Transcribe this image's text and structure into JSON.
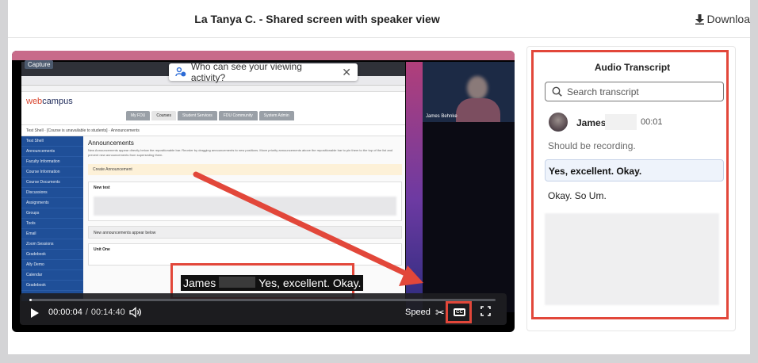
{
  "header": {
    "title": "La Tanya C. - Shared screen with speaker view",
    "download_label": "Downloa",
    "download_icon": "download-arrow-icon"
  },
  "shared_screen": {
    "capture_badge": "Capture",
    "privacy_popup": "Who can see your viewing activity?",
    "speaker_tile_name": "James Behnke",
    "campus_logo_a": "web",
    "campus_logo_b": "campus",
    "nav_tabs": [
      "My FDU",
      "Courses",
      "Student Services",
      "FDU Community",
      "System Admin"
    ],
    "breadcrumb": "Test Shell  ·  [Course is unavailable to students]  ·  Announcements",
    "left_nav": [
      "Test Shell",
      "Announcements",
      "Faculty Information",
      "Course Information",
      "Course Documents",
      "Discussions",
      "Assignments",
      "Groups",
      "Tools",
      "Email",
      "Zoom Sessions",
      "Gradebook",
      "Ally Demo",
      "Calendar",
      "Gradebook"
    ],
    "content_title": "Announcements",
    "content_desc": "New Announcements appear directly below the repositionable bar. Reorder by dragging announcements to new positions. Move priority announcements above the repositionable bar to pin them to the top of the list and prevent new announcements from superseding them.",
    "create_bar": "Create Announcement",
    "card1_title": "New test",
    "row_text": "New announcements appear below",
    "card2_title": "Unit One"
  },
  "caption": {
    "speaker": "James",
    "text": "Yes, excellent. Okay."
  },
  "controls": {
    "current_time": "00:00:04",
    "separator": "/",
    "total_time": "00:14:40",
    "progress": 0.005,
    "speed_label": "Speed",
    "cc_label": "CC"
  },
  "transcript": {
    "title": "Audio Transcript",
    "search_placeholder": "Search transcript",
    "speaker": "James",
    "timestamp": "00:01",
    "lines": [
      "Should be recording.",
      "Yes, excellent. Okay.",
      "Okay. So Um."
    ]
  },
  "colors": {
    "annotation_red": "#e2473a",
    "active_line_bg": "#eef3fb"
  }
}
